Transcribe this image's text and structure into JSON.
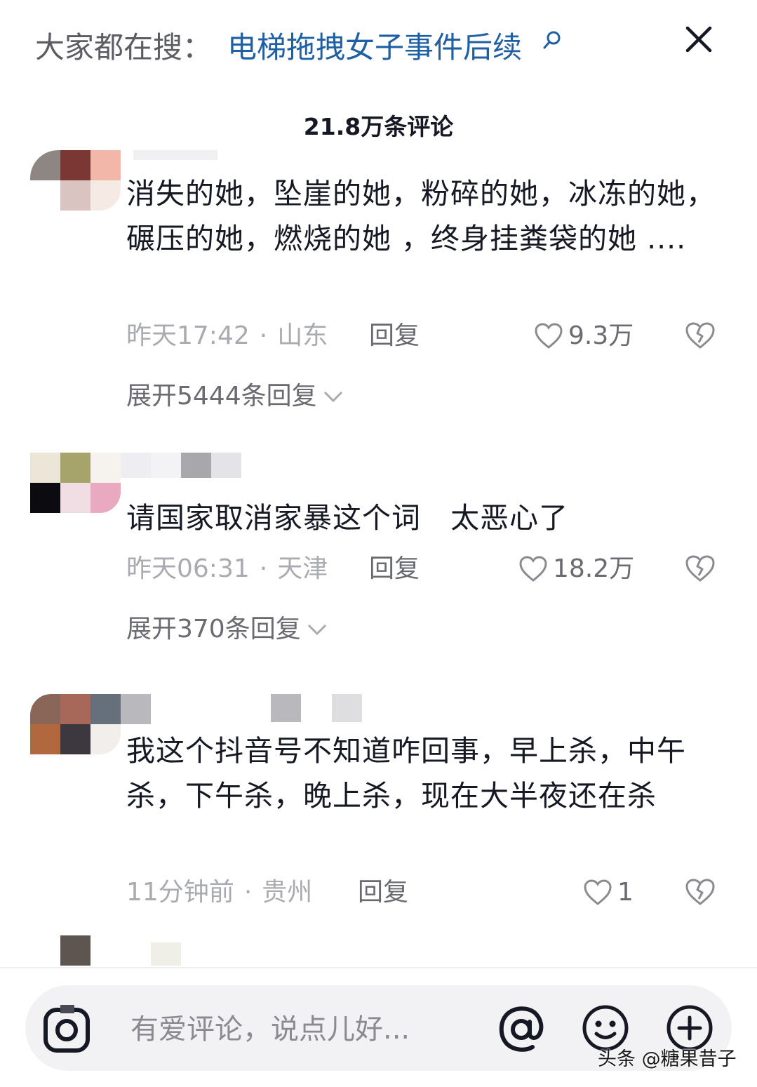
{
  "header": {
    "search_prefix": "大家都在搜：",
    "search_term": "电梯拖拽女子事件后续",
    "comment_count": "21.8万条评论"
  },
  "comments": [
    {
      "text": "消失的她，坠崖的她，粉碎的她，冰冻的她，碾压的她，燃烧的她 ，终身挂粪袋的她 ....",
      "time": "昨天17:42",
      "location": "山东",
      "reply_label": "回复",
      "likes": "9.3万",
      "expand_label": "展开5444条回复"
    },
    {
      "text": "请国家取消家暴这个词   太恶心了",
      "time": "昨天06:31",
      "location": "天津",
      "reply_label": "回复",
      "likes": "18.2万",
      "expand_label": "展开370条回复"
    },
    {
      "text": "我这个抖音号不知道咋回事，早上杀，中午杀，下午杀，晚上杀，现在大半夜还在杀",
      "time": "11分钟前",
      "location": "贵州",
      "reply_label": "回复",
      "likes": "1"
    }
  ],
  "input": {
    "placeholder": "有爱评论，说点儿好..."
  },
  "watermark": "头条 @糖果昔子",
  "colors": {
    "accent_link": "#1f5fa3",
    "text_primary": "#161823",
    "text_meta": "#a9abb0"
  },
  "icons": [
    "search-icon",
    "close-icon",
    "heart-icon",
    "broken-heart-icon",
    "chevron-down-icon",
    "camera-icon",
    "at-icon",
    "emoji-icon",
    "plus-icon"
  ]
}
